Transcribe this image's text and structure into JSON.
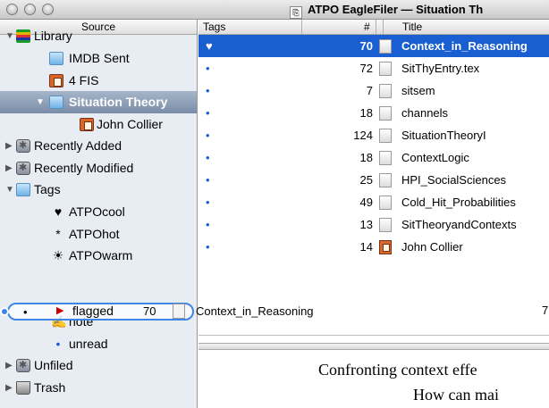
{
  "window": {
    "title": "ATPO EagleFiler — Situation Th"
  },
  "sidebar": {
    "header": "Source",
    "items": [
      {
        "label": "Library",
        "icon": "library-icon"
      },
      {
        "label": "IMDB Sent",
        "icon": "folder-icon"
      },
      {
        "label": "4 FIS",
        "icon": "book-icon"
      },
      {
        "label": "Situation Theory",
        "icon": "folder-icon",
        "selected": true
      },
      {
        "label": "John Collier",
        "icon": "book-icon"
      },
      {
        "label": "Recently Added",
        "icon": "smart-folder-icon"
      },
      {
        "label": "Recently Modified",
        "icon": "smart-folder-icon"
      },
      {
        "label": "Tags",
        "icon": "folder-icon"
      },
      {
        "label": "ATPOcool",
        "glyph": "♥"
      },
      {
        "label": "ATPOhot",
        "glyph": "*"
      },
      {
        "label": "ATPOwarm",
        "glyph": "☀"
      },
      {
        "label": "note",
        "glyph": "✍"
      },
      {
        "label": "unread",
        "glyph": "•"
      },
      {
        "label": "Unfiled",
        "icon": "smart-folder-icon"
      },
      {
        "label": "Trash",
        "icon": "trash-icon"
      }
    ]
  },
  "drag_ghost": {
    "tag": "flagged",
    "count": "70",
    "title": "Context_in_Reasoning",
    "tail": "7"
  },
  "list": {
    "headers": {
      "tags": "Tags",
      "num": "#",
      "title": "Title"
    },
    "rows": [
      {
        "tag": "♥",
        "num": "70",
        "title": "Context_in_Reasoning",
        "selected": true,
        "icon": "document"
      },
      {
        "tag": "•",
        "num": "72",
        "title": "SitThyEntry.tex",
        "icon": "document"
      },
      {
        "tag": "•",
        "num": "7",
        "title": "sitsem",
        "icon": "document"
      },
      {
        "tag": "•",
        "num": "18",
        "title": "channels",
        "icon": "document"
      },
      {
        "tag": "•",
        "num": "124",
        "title": "SituationTheoryI",
        "icon": "document"
      },
      {
        "tag": "•",
        "num": "18",
        "title": "ContextLogic",
        "icon": "document"
      },
      {
        "tag": "•",
        "num": "25",
        "title": "HPI_SocialSciences",
        "icon": "document"
      },
      {
        "tag": "•",
        "num": "49",
        "title": "Cold_Hit_Probabilities",
        "icon": "document"
      },
      {
        "tag": "•",
        "num": "13",
        "title": "SitTheoryandContexts",
        "icon": "document"
      },
      {
        "tag": "•",
        "num": "14",
        "title": "John Collier",
        "icon": "book"
      }
    ]
  },
  "preview": {
    "line1": "Confronting context effe",
    "line2": "How can mai"
  },
  "colors": {
    "selection": "#1a5fd1",
    "sidebar_bg": "#e8edf3",
    "drag_outline": "#3e86e6"
  }
}
